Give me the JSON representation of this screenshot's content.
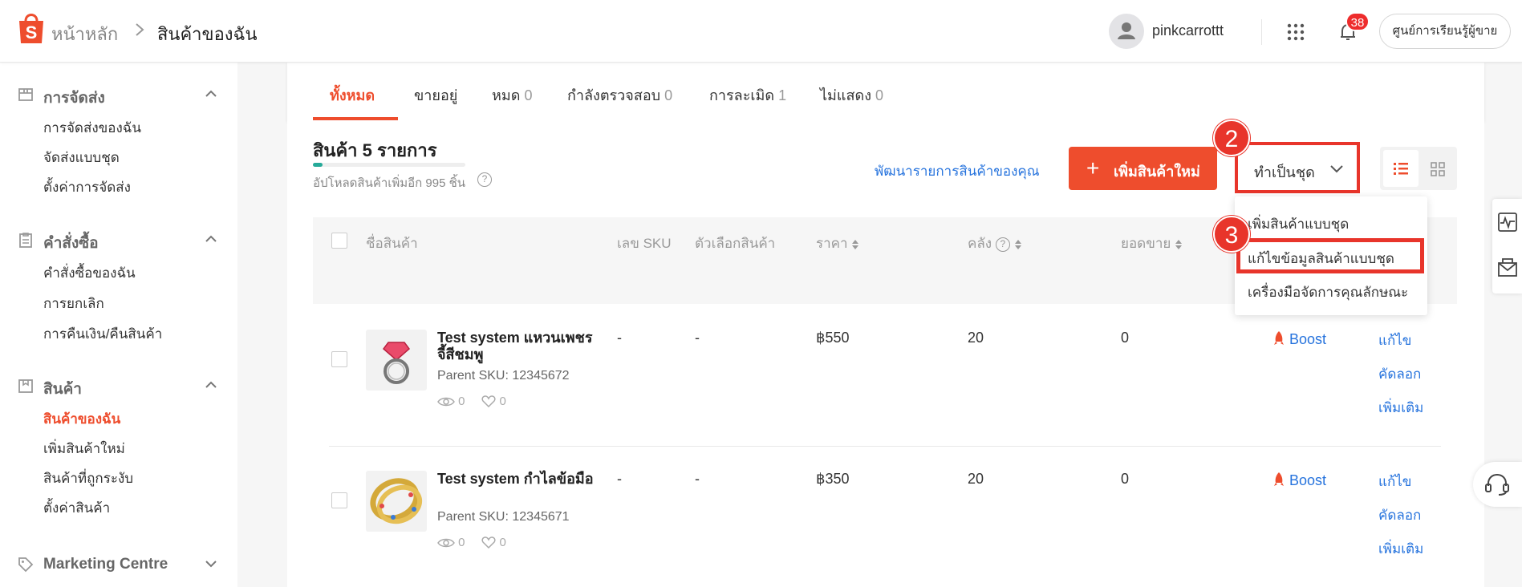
{
  "header": {
    "breadcrumb_home": "หน้าหลัก",
    "breadcrumb_current": "สินค้าของฉัน",
    "username": "pinkcarrottt",
    "notification_count": "38",
    "learning_center": "ศูนย์การเรียนรู้ผู้ขาย"
  },
  "sidebar": {
    "sections": [
      {
        "title": "การจัดส่ง",
        "items": [
          "การจัดส่งของฉัน",
          "จัดส่งแบบชุด",
          "ตั้งค่าการจัดส่ง"
        ]
      },
      {
        "title": "คำสั่งซื้อ",
        "items": [
          "คำสั่งซื้อของฉัน",
          "การยกเลิก",
          "การคืนเงิน/คืนสินค้า"
        ]
      },
      {
        "title": "สินค้า",
        "items": [
          "สินค้าของฉัน",
          "เพิ่มสินค้าใหม่",
          "สินค้าที่ถูกระงับ",
          "ตั้งค่าสินค้า"
        ]
      },
      {
        "title": "Marketing Centre",
        "items": []
      }
    ],
    "active_item": "สินค้าของฉัน"
  },
  "tabs": [
    {
      "label": "ทั้งหมด",
      "count": ""
    },
    {
      "label": "ขายอยู่",
      "count": ""
    },
    {
      "label": "หมด",
      "count": "0"
    },
    {
      "label": "กำลังตรวจสอบ",
      "count": "0"
    },
    {
      "label": "การละเมิด",
      "count": "1"
    },
    {
      "label": "ไม่แสดง",
      "count": "0"
    }
  ],
  "toolbar": {
    "product_count_title": "สินค้า 5 รายการ",
    "upload_hint": "อัปโหลดสินค้าเพิ่มอีก 995 ชิ้น",
    "upload_progress": 0.005,
    "improve_link": "พัฒนารายการสินค้าของคุณ",
    "add_product": "เพิ่มสินค้าใหม่",
    "batch_button": "ทำเป็นชุด"
  },
  "batch_menu": {
    "items": [
      "เพิ่มสินค้าแบบชุด",
      "แก้ไขข้อมูลสินค้าแบบชุด",
      "เครื่องมือจัดการคุณลักษณะ"
    ],
    "highlighted_index": 1
  },
  "step_markers": [
    "2",
    "3"
  ],
  "table": {
    "columns": [
      "ชื่อสินค้า",
      "เลข SKU",
      "ตัวเลือกสินค้า",
      "ราคา",
      "คลัง",
      "ยอดขาย"
    ],
    "rows": [
      {
        "name": "Test system แหวนเพชรจี้สีชมพู",
        "parent_sku": "Parent SKU: 12345672",
        "views": "0",
        "likes": "0",
        "sku": "-",
        "variation": "-",
        "price": "฿550",
        "stock": "20",
        "sales": "0",
        "boost": "Boost",
        "actions": [
          "แก้ไข",
          "คัดลอก",
          "เพิ่มเติม"
        ]
      },
      {
        "name": "Test system กำไลข้อมือ",
        "parent_sku": "Parent SKU: 12345671",
        "views": "0",
        "likes": "0",
        "sku": "-",
        "variation": "-",
        "price": "฿350",
        "stock": "20",
        "sales": "0",
        "boost": "Boost",
        "actions": [
          "แก้ไข",
          "คัดลอก",
          "เพิ่มเติม"
        ]
      }
    ]
  },
  "colors": {
    "brand": "#ee4d2d",
    "link": "#2673dd",
    "highlight": "#e8352b"
  }
}
